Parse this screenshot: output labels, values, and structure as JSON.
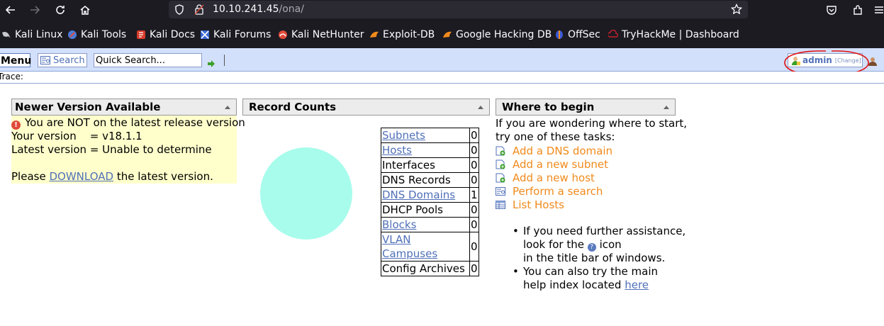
{
  "browser": {
    "url_host": "10.10.241.45",
    "url_path": "/ona/"
  },
  "bookmarks": [
    {
      "label": "Kali Linux",
      "icon": "kali-dragon-icon"
    },
    {
      "label": "Kali Tools",
      "icon": "kali-tools-icon"
    },
    {
      "label": "Kali Docs",
      "icon": "kali-docs-icon"
    },
    {
      "label": "Kali Forums",
      "icon": "kali-forums-icon"
    },
    {
      "label": "Kali NetHunter",
      "icon": "nethunter-icon"
    },
    {
      "label": "Exploit-DB",
      "icon": "exploit-db-icon"
    },
    {
      "label": "Google Hacking DB",
      "icon": "ghdb-icon"
    },
    {
      "label": "OffSec",
      "icon": "offsec-icon"
    },
    {
      "label": "TryHackMe | Dashboard",
      "icon": "tryhackme-icon"
    }
  ],
  "ona_bar": {
    "menu_label": "Menu",
    "search_label": "Search",
    "quick_search_value": "Quick Search...",
    "user_name": "admin",
    "user_change": "[Change]",
    "trace_label": "Trace:"
  },
  "newer_panel": {
    "title": "Newer Version Available",
    "warning": "You are NOT on the latest release version",
    "your_version_label": "Your version    = v18.1.1",
    "latest_version_label": "Latest version = Unable to determine",
    "please": "Please",
    "download": "DOWNLOAD",
    "tail": "the latest version."
  },
  "record_panel": {
    "title": "Record Counts",
    "rows": [
      {
        "name": "Subnets",
        "count": "0",
        "link": true
      },
      {
        "name": "Hosts",
        "count": "0",
        "link": true
      },
      {
        "name": "Interfaces",
        "count": "0",
        "link": false
      },
      {
        "name": "DNS Records",
        "count": "0",
        "link": false
      },
      {
        "name": "DNS Domains",
        "count": "1",
        "link": true
      },
      {
        "name": "DHCP Pools",
        "count": "0",
        "link": false
      },
      {
        "name": "Blocks",
        "count": "0",
        "link": true
      },
      {
        "name": "VLAN Campuses",
        "count": "0",
        "link": true
      },
      {
        "name": "Config Archives",
        "count": "0",
        "link": false
      }
    ]
  },
  "where_panel": {
    "title": "Where to begin",
    "intro1": "If you are wondering where to start,",
    "intro2": "try one of these tasks:",
    "tasks": [
      {
        "label": "Add a DNS domain",
        "icon": "add-record-icon"
      },
      {
        "label": "Add a new subnet",
        "icon": "add-record-icon"
      },
      {
        "label": "Add a new host",
        "icon": "add-record-icon"
      },
      {
        "label": "Perform a search",
        "icon": "search-form-icon"
      },
      {
        "label": "List Hosts",
        "icon": "list-table-icon"
      }
    ],
    "b1_l1": "If you need further assistance,",
    "b1_l2a": "look for the",
    "b1_l2b": "icon",
    "b1_l3": "in the title bar of windows.",
    "b2_l1": "You can also try the main",
    "b2_l2": "help index located",
    "b2_link": "here"
  },
  "colors": {
    "ona_bar_bg": "#d3e0fc",
    "link": "#5070b8",
    "task_orange": "#f08a1c",
    "warning_bg": "#ffffcc",
    "circle": "#a8fcec"
  }
}
